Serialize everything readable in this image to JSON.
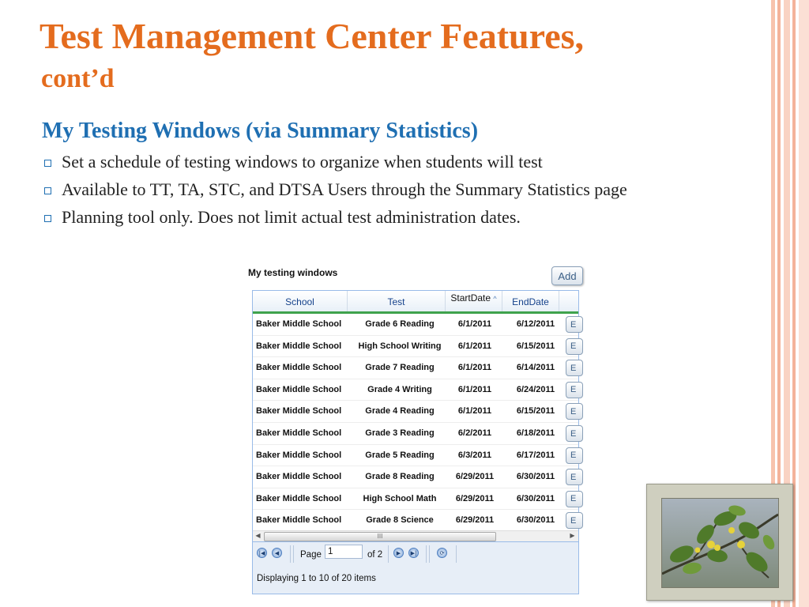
{
  "slide": {
    "title": "Test Management Center Features,",
    "subtitle": "cont’d",
    "section_heading": "My Testing Windows (via Summary Statistics)",
    "bullets": [
      "Set a schedule of testing windows to organize when students will test",
      "Available to TT, TA, STC, and DTSA Users through the Summary Statistics page",
      "Planning tool only. Does not limit actual test administration dates."
    ]
  },
  "widget": {
    "title": "My testing windows",
    "add_label": "Add",
    "columns": [
      "School",
      "Test",
      "StartDate",
      "EndDate"
    ],
    "sort_indicator": "^",
    "edit_label": "E",
    "rows": [
      {
        "school": "Baker Middle School",
        "test": "Grade 6 Reading",
        "start": "6/1/2011",
        "end": "6/12/2011"
      },
      {
        "school": "Baker Middle School",
        "test": "High School Writing",
        "start": "6/1/2011",
        "end": "6/15/2011"
      },
      {
        "school": "Baker Middle School",
        "test": "Grade 7 Reading",
        "start": "6/1/2011",
        "end": "6/14/2011"
      },
      {
        "school": "Baker Middle School",
        "test": "Grade 4 Writing",
        "start": "6/1/2011",
        "end": "6/24/2011"
      },
      {
        "school": "Baker Middle School",
        "test": "Grade 4 Reading",
        "start": "6/1/2011",
        "end": "6/15/2011"
      },
      {
        "school": "Baker Middle School",
        "test": "Grade 3 Reading",
        "start": "6/2/2011",
        "end": "6/18/2011"
      },
      {
        "school": "Baker Middle School",
        "test": "Grade 5 Reading",
        "start": "6/3/2011",
        "end": "6/17/2011"
      },
      {
        "school": "Baker Middle School",
        "test": "Grade 8 Reading",
        "start": "6/29/2011",
        "end": "6/30/2011"
      },
      {
        "school": "Baker Middle School",
        "test": "High School Math",
        "start": "6/29/2011",
        "end": "6/30/2011"
      },
      {
        "school": "Baker Middle School",
        "test": "Grade 8 Science",
        "start": "6/29/2011",
        "end": "6/30/2011"
      }
    ],
    "scrollbar": {
      "grip": "III",
      "left_arrow": "◀",
      "right_arrow": "▶"
    },
    "pager": {
      "page_label": "Page",
      "page_value": "1",
      "of_label": "of 2",
      "display_message": "Displaying 1 to 10 of 20 items",
      "icons": [
        "first-page-icon",
        "prev-page-icon",
        "next-page-icon",
        "last-page-icon",
        "refresh-icon"
      ]
    }
  },
  "colors": {
    "title": "#e46c1e",
    "heading": "#1f6fb2",
    "grid_border": "#99bbe8",
    "header_accent": "#3fa34d",
    "stripe": "#f4b39a"
  }
}
